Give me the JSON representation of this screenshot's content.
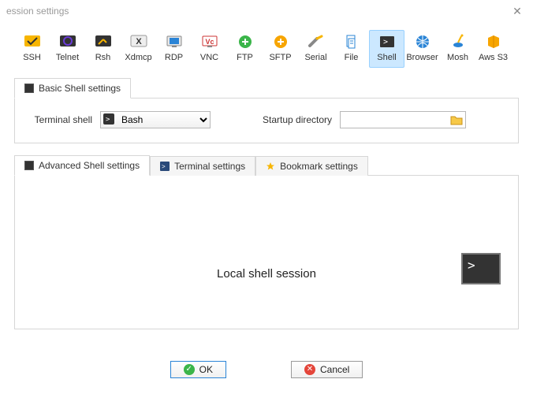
{
  "window": {
    "title": "ession settings"
  },
  "session_types": [
    {
      "id": "ssh",
      "label": "SSH"
    },
    {
      "id": "telnet",
      "label": "Telnet"
    },
    {
      "id": "rsh",
      "label": "Rsh"
    },
    {
      "id": "xdmcp",
      "label": "Xdmcp"
    },
    {
      "id": "rdp",
      "label": "RDP"
    },
    {
      "id": "vnc",
      "label": "VNC"
    },
    {
      "id": "ftp",
      "label": "FTP"
    },
    {
      "id": "sftp",
      "label": "SFTP"
    },
    {
      "id": "serial",
      "label": "Serial"
    },
    {
      "id": "file",
      "label": "File"
    },
    {
      "id": "shell",
      "label": "Shell",
      "selected": true
    },
    {
      "id": "browser",
      "label": "Browser"
    },
    {
      "id": "mosh",
      "label": "Mosh"
    },
    {
      "id": "awss3",
      "label": "Aws S3"
    }
  ],
  "basic_tab": {
    "label": "Basic Shell settings",
    "terminal_shell_label": "Terminal shell",
    "terminal_shell_value": "Bash",
    "startup_dir_label": "Startup directory",
    "startup_dir_value": ""
  },
  "lower_tabs": {
    "advanced": "Advanced Shell settings",
    "terminal": "Terminal settings",
    "bookmark": "Bookmark settings"
  },
  "preview": {
    "title": "Local shell session",
    "prompt": ">"
  },
  "footer": {
    "ok": "OK",
    "cancel": "Cancel"
  }
}
